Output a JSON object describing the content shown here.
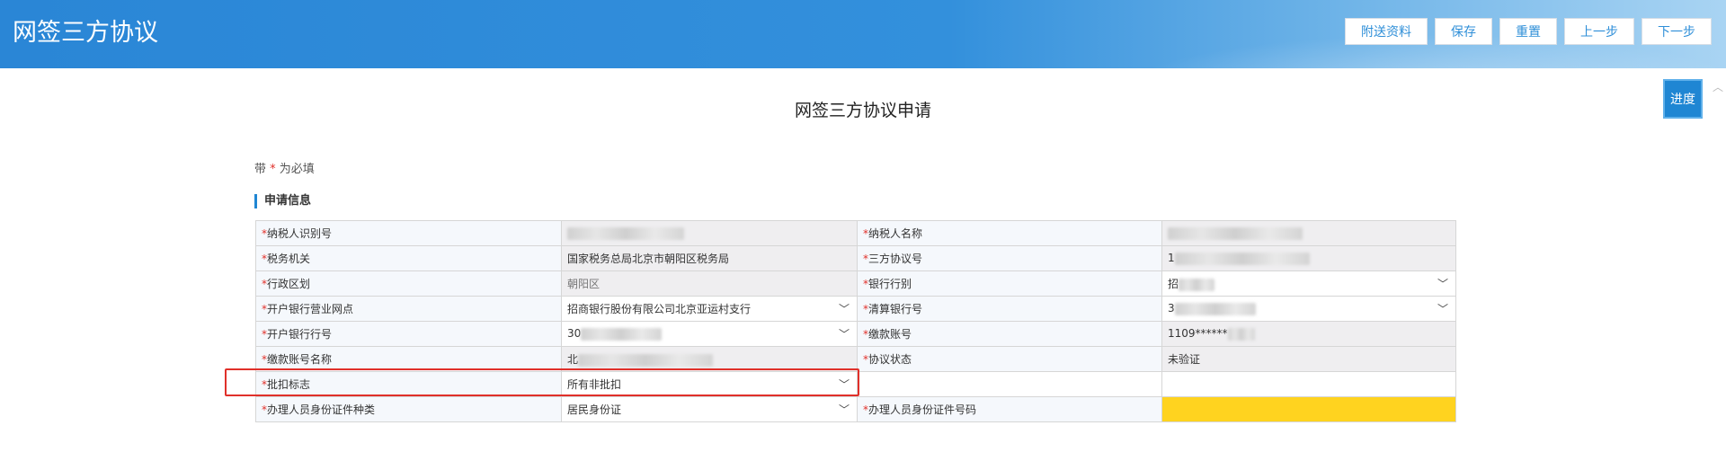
{
  "header": {
    "title": "网签三方协议",
    "buttons": [
      "附送资料",
      "保存",
      "重置",
      "上一步",
      "下一步"
    ]
  },
  "side": {
    "progress_label": "进度"
  },
  "page_title": "网签三方协议申请",
  "required_note": {
    "prefix": "带",
    "star": "*",
    "suffix": "为必填"
  },
  "section_title": "申请信息",
  "form": {
    "star": "*",
    "taxpayer_id_label": "纳税人识别号",
    "taxpayer_name_label": "纳税人名称",
    "tax_office_label": "税务机关",
    "tax_office_value": "国家税务总局北京市朝阳区税务局",
    "agreement_no_label": "三方协议号",
    "agreement_no_prefix": "1",
    "district_label": "行政区划",
    "district_value": "朝阳区",
    "bank_type_label": "银行行别",
    "bank_type_prefix": "招",
    "bank_branch_label": "开户银行营业网点",
    "bank_branch_value": "招商银行股份有限公司北京亚运村支行",
    "clearing_bank_label": "清算银行号",
    "clearing_bank_prefix": "3",
    "bank_no_label": "开户银行行号",
    "bank_no_prefix": "30",
    "payment_account_label": "缴款账号",
    "payment_account_value": "1109******",
    "account_name_label": "缴款账号名称",
    "account_name_prefix": "北",
    "agreement_status_label": "协议状态",
    "agreement_status_value": "未验证",
    "batch_flag_label": "批扣标志",
    "batch_flag_value": "所有非批扣",
    "id_type_label": "办理人员身份证件种类",
    "id_type_value": "居民身份证",
    "id_no_label": "办理人员身份证件号码",
    "id_no_value": ""
  },
  "colors": {
    "header_blue": "#2a86d6",
    "required_star": "#e0302a",
    "highlight_box": "#e0302a",
    "id_field_fill": "#ffd31f"
  }
}
